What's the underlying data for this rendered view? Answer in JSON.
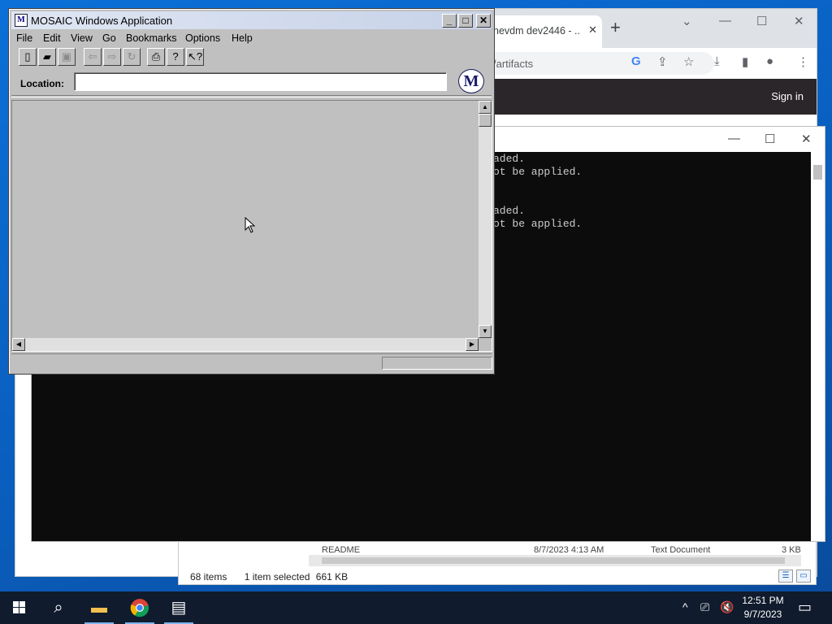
{
  "chrome": {
    "tab_title": "nevdm dev2446 - ...",
    "omnibox_text": "/artifacts",
    "sign_in": "Sign in"
  },
  "console": {
    "lines": [
      "aded.",
      "ot be applied.",
      "",
      "",
      "aded.",
      "ot be applied."
    ]
  },
  "explorer": {
    "row_name": "README",
    "row_date": "8/7/2023 4:13 AM",
    "row_type": "Text Document",
    "row_size": "3 KB",
    "item_count": "68 items",
    "selection": "1 item selected",
    "selection_size": "661 KB"
  },
  "mosaic": {
    "title": "MOSAIC Windows Application",
    "menu": [
      "File",
      "Edit",
      "View",
      "Go",
      "Bookmarks",
      "Options",
      "Help"
    ],
    "location_label": "Location:",
    "location_value": "",
    "logo_letter": "M"
  },
  "taskbar": {
    "time": "12:51 PM",
    "date": "9/7/2023"
  }
}
